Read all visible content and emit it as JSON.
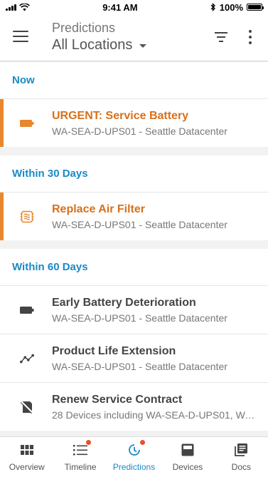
{
  "status_bar": {
    "time": "9:41 AM",
    "battery": "100%",
    "icons": [
      "signal-icon",
      "wifi-icon",
      "bluetooth-icon",
      "battery-icon"
    ]
  },
  "header": {
    "subtitle": "Predictions",
    "location": "All Locations",
    "icons": [
      "menu-icon",
      "filter-icon",
      "more-vertical-icon",
      "chevron-down-icon"
    ]
  },
  "sections": [
    {
      "title": "Now",
      "items": [
        {
          "title": "URGENT: Service Battery",
          "subtitle": "WA-SEA-D-UPS01 - Seattle Datacenter",
          "icon": "battery-icon",
          "highlighted": true
        }
      ]
    },
    {
      "title": "Within 30 Days",
      "items": [
        {
          "title": "Replace Air Filter",
          "subtitle": "WA-SEA-D-UPS01 - Seattle Datacenter",
          "icon": "air-filter-icon",
          "highlighted": true
        }
      ]
    },
    {
      "title": "Within 60 Days",
      "items": [
        {
          "title": "Early Battery Deterioration",
          "subtitle": "WA-SEA-D-UPS01 - Seattle Datacenter",
          "icon": "battery-icon",
          "highlighted": false
        },
        {
          "title": "Product Life Extension",
          "subtitle": "WA-SEA-D-UPS01 - Seattle Datacenter",
          "icon": "trend-line-icon",
          "highlighted": false
        },
        {
          "title": "Renew Service Contract",
          "subtitle": "28 Devices including WA-SEA-D-UPS01, WA...",
          "icon": "contract-off-icon",
          "highlighted": false
        }
      ]
    }
  ],
  "tabs": [
    {
      "label": "Overview",
      "icon": "grid-icon",
      "active": false,
      "badge": false
    },
    {
      "label": "Timeline",
      "icon": "timeline-list-icon",
      "active": false,
      "badge": true
    },
    {
      "label": "Predictions",
      "icon": "predictions-clock-icon",
      "active": true,
      "badge": true
    },
    {
      "label": "Devices",
      "icon": "device-icon",
      "active": false,
      "badge": false
    },
    {
      "label": "Docs",
      "icon": "docs-icon",
      "active": false,
      "badge": false
    }
  ],
  "colors": {
    "accent_blue": "#1a8ac6",
    "urgent_orange": "#e8872d",
    "urgent_text": "#d8701b",
    "badge_red": "#e8502d"
  }
}
